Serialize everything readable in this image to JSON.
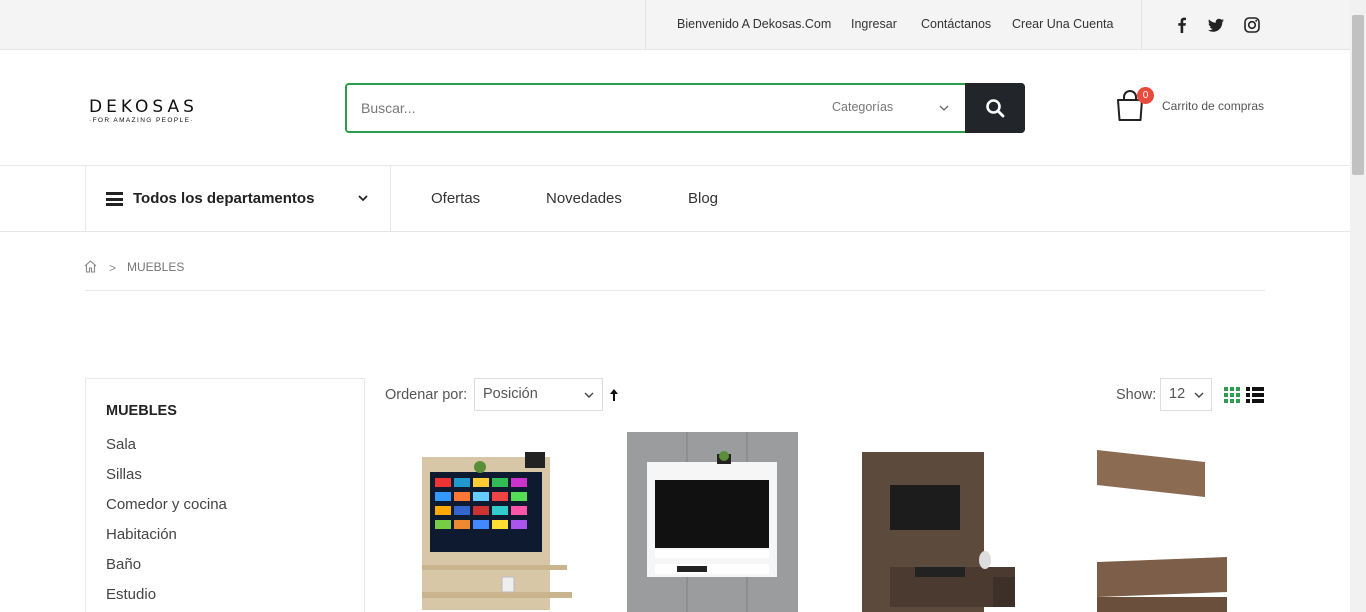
{
  "topbar": {
    "welcome": "Bienvenido A Dekosas.Com",
    "login": "Ingresar",
    "contact": "Contáctanos",
    "create_account": "Crear Una Cuenta",
    "social": [
      "facebook-icon",
      "twitter-icon",
      "instagram-icon"
    ]
  },
  "header": {
    "logo_name": "DEKOSAS",
    "logo_tagline": "·FOR AMAZING PEOPLE·",
    "search_placeholder": "Buscar...",
    "category_select": "Categorías",
    "cart_count": "0",
    "cart_label": "Carrito de compras"
  },
  "nav": {
    "departments": "Todos los departamentos",
    "links": [
      "Ofertas",
      "Novedades",
      "Blog"
    ]
  },
  "breadcrumb": {
    "separator": ">",
    "current": "MUEBLES"
  },
  "sidebar": {
    "title": "MUEBLES",
    "items": [
      "Sala",
      "Sillas",
      "Comedor y cocina",
      "Habitación",
      "Baño",
      "Estudio"
    ]
  },
  "toolbar": {
    "sort_label": "Ordenar por:",
    "sort_value": "Posición",
    "show_label": "Show:",
    "show_value": "12"
  },
  "colors": {
    "accent_green": "#2e9b4f",
    "dark_button": "#222529",
    "badge_red": "#e74c3c"
  }
}
